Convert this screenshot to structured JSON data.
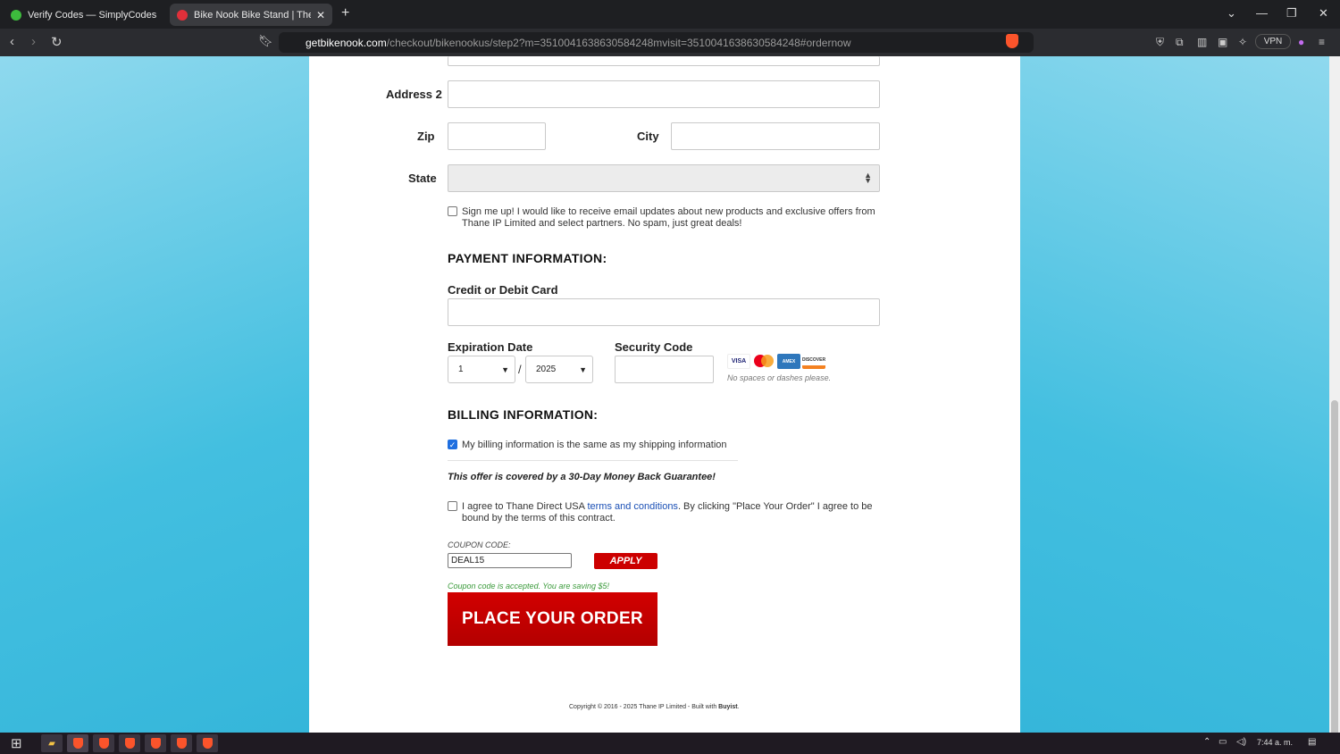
{
  "browser": {
    "tabs": [
      {
        "title": "Verify Codes — SimplyCodes",
        "active": false,
        "favicon_color": "#3dbb3d"
      },
      {
        "title": "Bike Nook Bike Stand | The Brill",
        "active": true,
        "favicon_color": "#e0303a"
      }
    ],
    "new_tab": "+",
    "url_host": "getbikenook.com",
    "url_path": "/checkout/bikenookus/step2?m=3510041638630584248mvisit=3510041638630584248#ordernow",
    "vpn_label": "VPN",
    "brave_badge": "10"
  },
  "form": {
    "address2_label": "Address 2",
    "zip_label": "Zip",
    "city_label": "City",
    "state_label": "State",
    "signup_text": "Sign me up! I would like to receive email updates about new products and exclusive offers from Thane IP Limited and select partners. No spam, just great deals!",
    "signup_checked": false
  },
  "payment": {
    "heading": "PAYMENT INFORMATION:",
    "card_label": "Credit or Debit Card",
    "expiration_label": "Expiration Date",
    "exp_month": "1",
    "exp_separator": "/",
    "exp_year": "2025",
    "security_label": "Security Code",
    "cards": [
      "VISA",
      "MC",
      "AMEX",
      "DISCOVER"
    ],
    "hint": "No spaces or dashes please."
  },
  "billing": {
    "heading": "BILLING INFORMATION:",
    "same_as_shipping": "My billing information is the same as my shipping information",
    "same_checked": true,
    "guarantee": "This offer is covered by a 30-Day Money Back Guarantee!",
    "agree_prefix": "I agree to Thane Direct USA ",
    "agree_link": "terms and conditions",
    "agree_suffix": ". By clicking \"Place Your Order\" I agree to be bound by the terms of this contract.",
    "agree_checked": false
  },
  "coupon": {
    "label": "COUPON CODE:",
    "value": "DEAL15",
    "apply_label": "APPLY",
    "message": "Coupon code is accepted. You are saving $5!"
  },
  "order_button": "PLACE YOUR ORDER",
  "footer": {
    "copyright": "Copyright © 2016 - 2025 Thane IP Limited - Built with ",
    "brand": "Buyist",
    "end": "."
  },
  "taskbar": {
    "time": "7:44 a. m."
  },
  "colors": {
    "accent_red": "#cc0000",
    "link_blue": "#1a4fb5",
    "success_green": "#3a9a3a"
  }
}
